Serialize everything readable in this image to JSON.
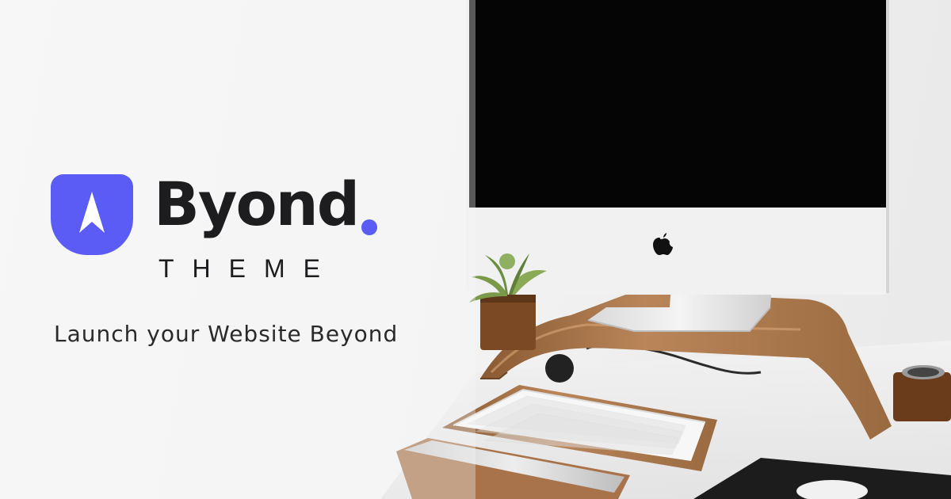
{
  "brand": {
    "name": "Byond",
    "subtitle": "THEME",
    "tagline": "Launch your Website Beyond",
    "accent_color": "#5a5cf5",
    "logo_icon": "arrow-up-icon"
  },
  "photo": {
    "objects": [
      "imac-monitor",
      "apple-logo-icon",
      "wooden-monitor-stand",
      "succulent-plant",
      "wireless-keyboard",
      "keyboard-wrist-rest",
      "pen-cup",
      "mouse",
      "mouse-pad"
    ]
  }
}
